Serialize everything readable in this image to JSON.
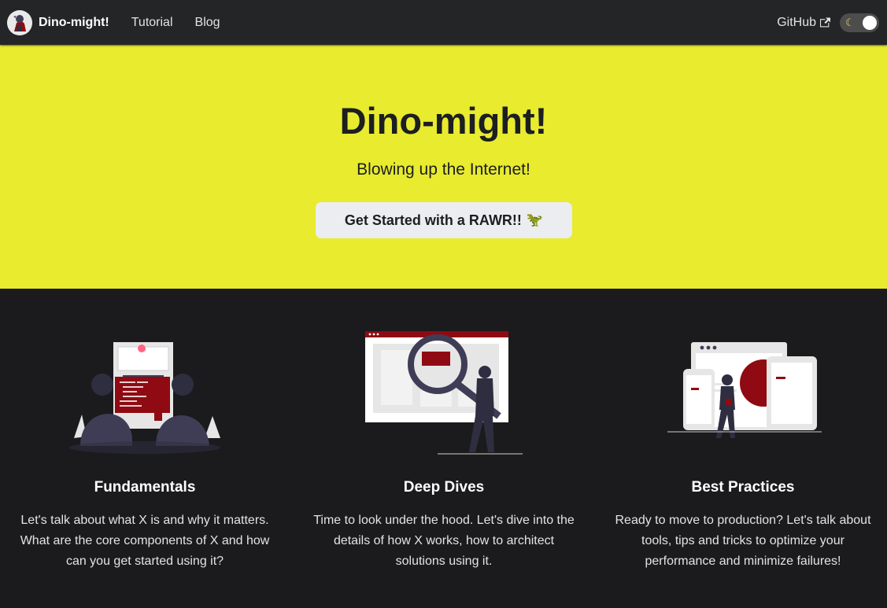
{
  "navbar": {
    "brand_title": "Dino-might!",
    "links": [
      {
        "label": "Tutorial"
      },
      {
        "label": "Blog"
      }
    ],
    "github_label": "GitHub",
    "theme_toggle": {
      "icon": "moon-icon",
      "state": "dark"
    }
  },
  "hero": {
    "title": "Dino-might!",
    "subtitle": "Blowing up the Internet!",
    "cta_label": "Get Started with a RAWR!!",
    "cta_icon": "🦖"
  },
  "features": [
    {
      "title": "Fundamentals",
      "text": "Let's talk about what X is and why it matters. What are the core components of X and how can you get started using it?",
      "illustration": "two-people-at-computer-illustration"
    },
    {
      "title": "Deep Dives",
      "text": "Time to look under the hood. Let's dive into the details of how X works, how to architect solutions using it.",
      "illustration": "magnifying-glass-illustration"
    },
    {
      "title": "Best Practices",
      "text": "Ready to move to production? Let's talk about tools, tips and tricks to optimize your performance and minimize failures!",
      "illustration": "multi-device-illustration"
    }
  ],
  "colors": {
    "navbar_bg": "#242526",
    "hero_bg": "#e8eb2e",
    "page_bg": "#1b1b1d",
    "accent_red": "#8f0a12"
  }
}
